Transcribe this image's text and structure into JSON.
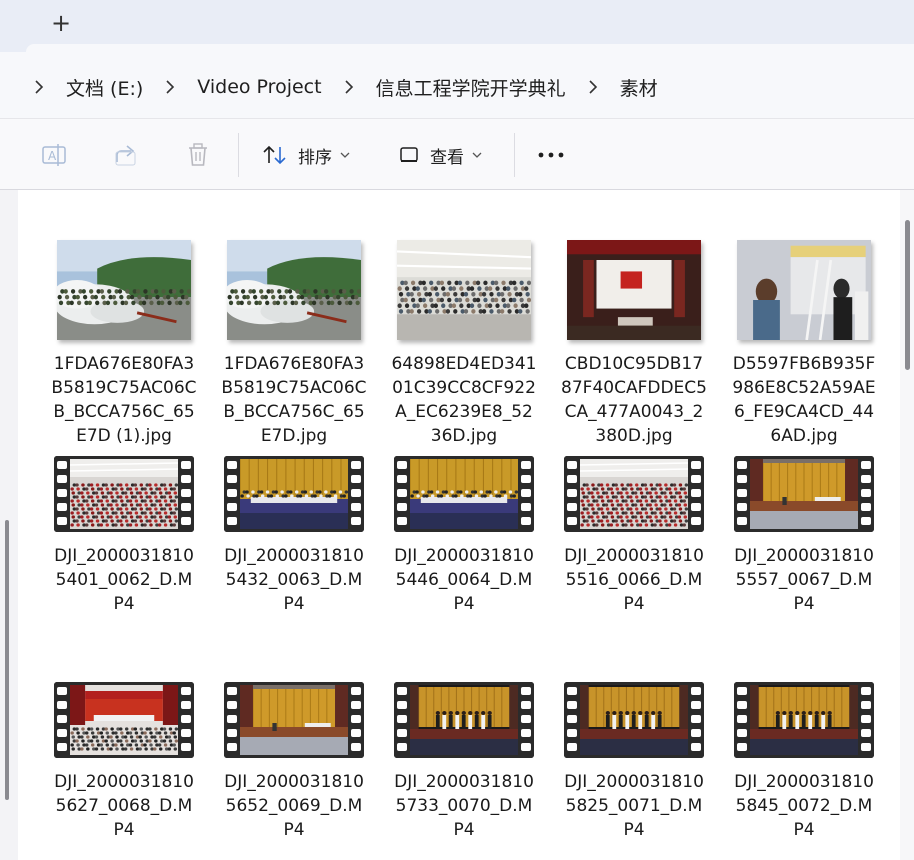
{
  "tabbar": {
    "new_tab_glyph": "+"
  },
  "breadcrumb": {
    "items": [
      "文档 (E:)",
      "Video Project",
      "信息工程学院开学典礼",
      "素材"
    ]
  },
  "toolbar": {
    "rename_icon": "rename-icon",
    "share_icon": "share-icon",
    "delete_icon": "delete-icon",
    "sort_label": "排序",
    "view_label": "查看",
    "more_glyph": "•••"
  },
  "files": {
    "row1": [
      {
        "name": "1FDA676E80FA3B5819C75AC06CB_BCCA756C_65E7D (1).jpg",
        "type": "photo",
        "scene": "smoke"
      },
      {
        "name": "1FDA676E80FA3B5819C75AC06CB_BCCA756C_65E7D.jpg",
        "type": "photo",
        "scene": "smoke"
      },
      {
        "name": "64898ED4ED34101C39CC8CF922A_EC6239E8_5236D.jpg",
        "type": "photo",
        "scene": "classroom"
      },
      {
        "name": "CBD10C95DB1787F40CAFDDEC5CA_477A0043_2380D.jpg",
        "type": "photo",
        "scene": "auditorium-red"
      },
      {
        "name": "D5597FB6B935F986E8C52A59AE6_FE9CA4CD_446AD.jpg",
        "type": "photo",
        "scene": "dorm"
      }
    ],
    "row2": [
      {
        "name": "DJI_20000318105401_0062_D.MP4",
        "type": "video",
        "scene": "hall-red-seats"
      },
      {
        "name": "DJI_20000318105432_0063_D.MP4",
        "type": "video",
        "scene": "stage-curtain"
      },
      {
        "name": "DJI_20000318105446_0064_D.MP4",
        "type": "video",
        "scene": "stage-curtain"
      },
      {
        "name": "DJI_20000318105516_0066_D.MP4",
        "type": "video",
        "scene": "hall-red-seats"
      },
      {
        "name": "DJI_20000318105557_0067_D.MP4",
        "type": "video",
        "scene": "stage-wide"
      }
    ],
    "row3": [
      {
        "name": "DJI_20000318105627_0068_D.MP4",
        "type": "video",
        "scene": "hall-banner"
      },
      {
        "name": "DJI_20000318105652_0069_D.MP4",
        "type": "video",
        "scene": "stage-wide"
      },
      {
        "name": "DJI_20000318105733_0070_D.MP4",
        "type": "video",
        "scene": "stage-people"
      },
      {
        "name": "DJI_20000318105825_0071_D.MP4",
        "type": "video",
        "scene": "stage-people"
      },
      {
        "name": "DJI_20000318105845_0072_D.MP4",
        "type": "video",
        "scene": "stage-people"
      }
    ]
  }
}
